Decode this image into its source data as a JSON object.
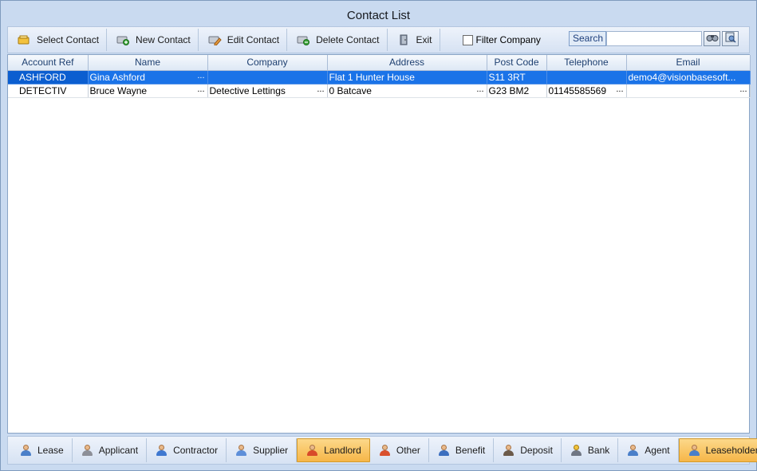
{
  "window": {
    "title": "Contact List"
  },
  "toolbar": {
    "buttons": [
      {
        "label": "Select Contact",
        "icon": "select-contact-icon"
      },
      {
        "label": "New Contact",
        "icon": "new-contact-icon"
      },
      {
        "label": "Edit Contact",
        "icon": "edit-contact-icon"
      },
      {
        "label": "Delete Contact",
        "icon": "delete-contact-icon"
      },
      {
        "label": "Exit",
        "icon": "exit-door-icon"
      }
    ],
    "filter_company_label": "Filter Company",
    "filter_company_checked": false,
    "search_label": "Search",
    "search_value": ""
  },
  "grid": {
    "columns": [
      "Account Ref",
      "Name",
      "Company",
      "Address",
      "Post Code",
      "Telephone",
      "Email"
    ],
    "rows": [
      {
        "account_ref": "ASHFORD",
        "name": "Gina Ashford",
        "company": "",
        "address": "Flat 1 Hunter House",
        "post_code": "S11 3RT",
        "telephone": "",
        "email": "demo4@visionbasesoft...",
        "selected": true
      },
      {
        "account_ref": "DETECTIV",
        "name": "Bruce Wayne",
        "company": "Detective Lettings",
        "address": "0 Batcave",
        "post_code": "G23 BM2",
        "telephone": "01145585569",
        "email": "",
        "selected": false
      }
    ],
    "ellipsis": "..."
  },
  "tabs": [
    {
      "label": "Lease",
      "active": false,
      "icon": "lease-people-icon"
    },
    {
      "label": "Applicant",
      "active": false,
      "icon": "applicant-icon"
    },
    {
      "label": "Contractor",
      "active": false,
      "icon": "contractor-icon"
    },
    {
      "label": "Supplier",
      "active": false,
      "icon": "supplier-icon"
    },
    {
      "label": "Landlord",
      "active": true,
      "icon": "landlord-icon"
    },
    {
      "label": "Other",
      "active": false,
      "icon": "other-person-icon"
    },
    {
      "label": "Benefit",
      "active": false,
      "icon": "benefit-icon"
    },
    {
      "label": "Deposit",
      "active": false,
      "icon": "deposit-icon"
    },
    {
      "label": "Bank",
      "active": false,
      "icon": "bank-icon"
    },
    {
      "label": "Agent",
      "active": false,
      "icon": "agent-icon"
    },
    {
      "label": "Leaseholder",
      "active": true,
      "icon": "leaseholder-icon"
    }
  ],
  "colors": {
    "selection": "#1a73e8",
    "active_tab": "#f6b648",
    "header_text": "#1d3f70"
  }
}
